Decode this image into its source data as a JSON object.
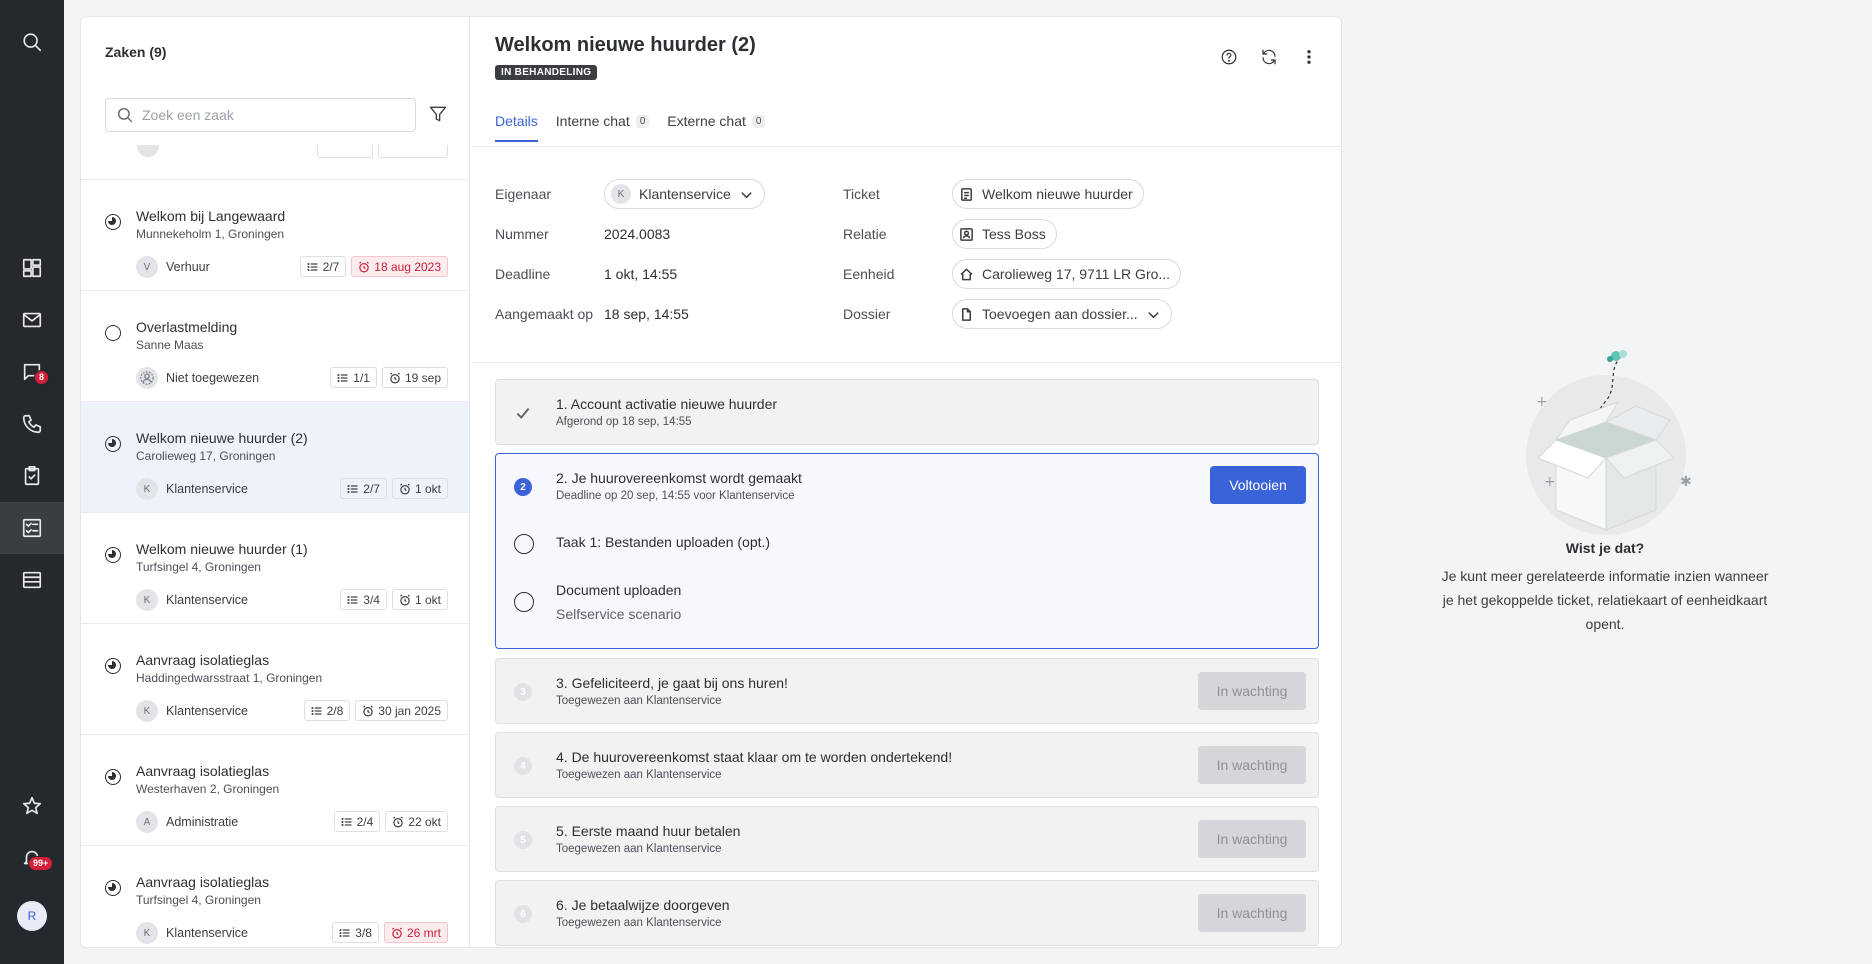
{
  "nav": {
    "messages_badge": "8",
    "notifications_badge": "99+",
    "avatar_initial": "R"
  },
  "list": {
    "title": "Zaken (9)",
    "search_placeholder": "Zoek een zaak",
    "items": [
      {
        "title": "Welkom bij Langewaard",
        "subtitle": "Munnekeholm 1, Groningen",
        "owner": "Verhuur",
        "owner_initial": "V",
        "tasks": "2/7",
        "deadline": "18 aug 2023",
        "overdue": true,
        "status": "in-progress"
      },
      {
        "title": "Overlastmelding",
        "subtitle": "Sanne Maas",
        "owner": "Niet toegewezen",
        "owner_initial": "",
        "tasks": "1/1",
        "deadline": "19 sep",
        "overdue": false,
        "status": "open"
      },
      {
        "title": "Welkom nieuwe huurder (2)",
        "subtitle": "Carolieweg 17, Groningen",
        "owner": "Klantenservice",
        "owner_initial": "K",
        "tasks": "2/7",
        "deadline": "1 okt",
        "overdue": false,
        "status": "in-progress"
      },
      {
        "title": "Welkom nieuwe huurder (1)",
        "subtitle": "Turfsingel 4, Groningen",
        "owner": "Klantenservice",
        "owner_initial": "K",
        "tasks": "3/4",
        "deadline": "1 okt",
        "overdue": false,
        "status": "in-progress"
      },
      {
        "title": "Aanvraag isolatieglas",
        "subtitle": "Haddingedwarsstraat 1, Groningen",
        "owner": "Klantenservice",
        "owner_initial": "K",
        "tasks": "2/8",
        "deadline": "30 jan 2025",
        "overdue": false,
        "status": "in-progress"
      },
      {
        "title": "Aanvraag isolatieglas",
        "subtitle": "Westerhaven 2, Groningen",
        "owner": "Administratie",
        "owner_initial": "A",
        "tasks": "2/4",
        "deadline": "22 okt",
        "overdue": false,
        "status": "in-progress"
      },
      {
        "title": "Aanvraag isolatieglas",
        "subtitle": "Turfsingel 4, Groningen",
        "owner": "Klantenservice",
        "owner_initial": "K",
        "tasks": "3/8",
        "deadline": "26 mrt",
        "overdue": true,
        "status": "in-progress"
      }
    ]
  },
  "detail": {
    "title": "Welkom nieuwe huurder (2)",
    "status": "IN BEHANDELING",
    "tabs": [
      {
        "label": "Details",
        "count": ""
      },
      {
        "label": "Interne chat",
        "count": "0"
      },
      {
        "label": "Externe chat",
        "count": "0"
      }
    ],
    "fields": {
      "owner_label": "Eigenaar",
      "owner_value": "Klantenservice",
      "owner_initial": "K",
      "number_label": "Nummer",
      "number_value": "2024.0083",
      "deadline_label": "Deadline",
      "deadline_value": "1 okt, 14:55",
      "created_label": "Aangemaakt op",
      "created_value": "18 sep, 14:55",
      "ticket_label": "Ticket",
      "ticket_value": "Welkom nieuwe huurder",
      "relation_label": "Relatie",
      "relation_value": "Tess Boss",
      "unit_label": "Eenheid",
      "unit_value": "Carolieweg 17, 9711 LR Gro...",
      "dossier_label": "Dossier",
      "dossier_value": "Toevoegen aan dossier..."
    },
    "tasks": [
      {
        "num": "1",
        "title": "1. Account activatie nieuwe huurder",
        "sub": "Afgerond op 18 sep, 14:55",
        "state": "done"
      },
      {
        "num": "2",
        "title": "2. Je huurovereenkomst wordt gemaakt",
        "sub": "Deadline op 20 sep, 14:55 voor Klantenservice",
        "state": "active",
        "button": "Voltooien",
        "subtasks": [
          {
            "title": "Taak 1: Bestanden uploaden (opt.)",
            "sub": ""
          },
          {
            "title": "Document uploaden",
            "sub": "Selfservice scenario"
          }
        ]
      },
      {
        "num": "3",
        "title": "3. Gefeliciteerd, je gaat bij ons huren!",
        "sub": "Toegewezen aan Klantenservice",
        "state": "waiting",
        "button": "In wachting"
      },
      {
        "num": "4",
        "title": "4. De huurovereenkomst staat klaar om te worden ondertekend!",
        "sub": "Toegewezen aan Klantenservice",
        "state": "waiting",
        "button": "In wachting"
      },
      {
        "num": "5",
        "title": "5. Eerste maand huur betalen",
        "sub": "Toegewezen aan Klantenservice",
        "state": "waiting",
        "button": "In wachting"
      },
      {
        "num": "6",
        "title": "6. Je betaalwijze doorgeven",
        "sub": "Toegewezen aan Klantenservice",
        "state": "waiting",
        "button": "In wachting"
      }
    ]
  },
  "hint": {
    "title": "Wist je dat?",
    "body": "Je kunt meer gerelateerde informatie inzien wanneer je het gekoppelde ticket, relatiekaart of eenheidkaart opent."
  },
  "colors": {
    "accent": "#3b63d9",
    "rail": "#25282c",
    "overdue": "#c8203a",
    "badge": "#d51f3a"
  }
}
